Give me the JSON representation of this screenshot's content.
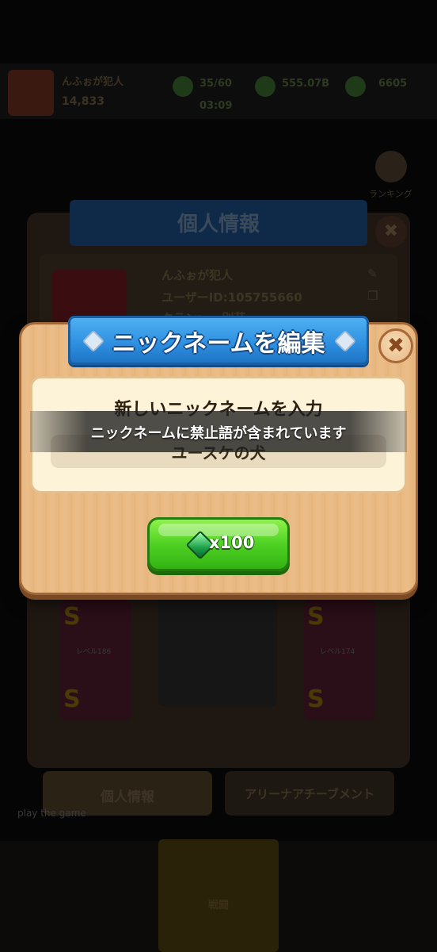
{
  "background": {
    "player_name": "んふぉが犯人",
    "power": "14,833",
    "resources": [
      "35/60",
      "555.07B",
      "6605"
    ],
    "timer": "03:09",
    "ranking_label": "ランキング",
    "panel_title": "個人情報",
    "info_name": "んふぉが犯人",
    "info_user_id": "ユーザーID:105755660",
    "info_clan": "クラン: 一 別荘",
    "tile_levels": [
      "レベル186",
      "レベル174"
    ],
    "tile_grade": "S",
    "tab_personal": "個人情報",
    "tab_arena": "アリーナアチーブメント",
    "tagline": "play the game",
    "bottom_center_label": "戦闘"
  },
  "dialog": {
    "title": "ニックネームを編集",
    "prompt": "新しいニックネームを入力",
    "input_value": "ユースケの犬",
    "toast": "ニックネームに禁止語が含まれています",
    "button_label": "x100",
    "close_symbol": "✖"
  },
  "colors": {
    "dialog_wood": "#ebbd88",
    "ribbon_blue": "#2d8ee0",
    "button_green": "#4fd023",
    "gem_green": "#1ea24a"
  },
  "icons": [
    "gem-icon",
    "close-icon",
    "edit-icon",
    "copy-icon"
  ]
}
